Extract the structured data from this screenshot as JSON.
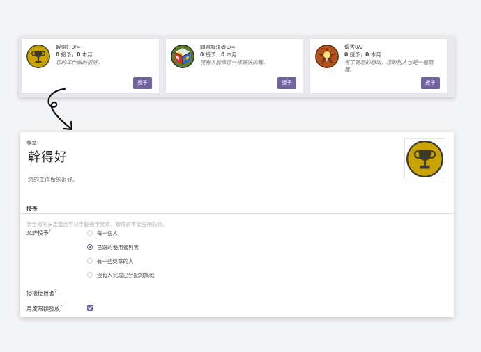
{
  "cards": [
    {
      "title": "幹得好0/∞",
      "granted_count": "0",
      "granted_label": " 授予，",
      "month_count": "0",
      "month_label": " 本月",
      "description": "您的工作做的很好。",
      "button": "授予",
      "icon": "trophy-icon"
    },
    {
      "title": "問題解決者0/∞",
      "granted_count": "0",
      "granted_label": " 授予，",
      "month_count": "0",
      "month_label": " 本月",
      "description": "沒有人能像您一樣解決挑戰。",
      "button": "授予",
      "icon": "rubiks-cube-icon"
    },
    {
      "title": "優秀0/2",
      "granted_count": "0",
      "granted_label": " 授予，",
      "month_count": "0",
      "month_label": " 本月",
      "description": "有了聰慧的想法，您對別人也是一種鼓舞。",
      "button": "授予",
      "icon": "lightbulb-star-icon"
    }
  ],
  "form": {
    "badge_label": "獎章",
    "badge_name": "幹得好",
    "description": "您的工作做的很好。",
    "section_title": "授予",
    "note": "安全規則未定義誰可以手動授予獎章。管理員不能強制執行。",
    "allow_grant_label": "允許授予",
    "allow_grant_options": [
      {
        "label": "每一個人",
        "checked": false
      },
      {
        "label": "已選的使用者列表",
        "checked": true
      },
      {
        "label": "有一些獎章的人",
        "checked": false
      },
      {
        "label": "沒有人完成已分配的挑戰",
        "checked": false
      }
    ],
    "authorized_users_label": "授權使用者",
    "monthly_limit_label": "月度限額發放",
    "monthly_limit_checked": true,
    "help_mark": "?"
  },
  "colors": {
    "accent": "#71639e",
    "trophy_gold": "#c9a400",
    "background": "#f3f4f6"
  }
}
